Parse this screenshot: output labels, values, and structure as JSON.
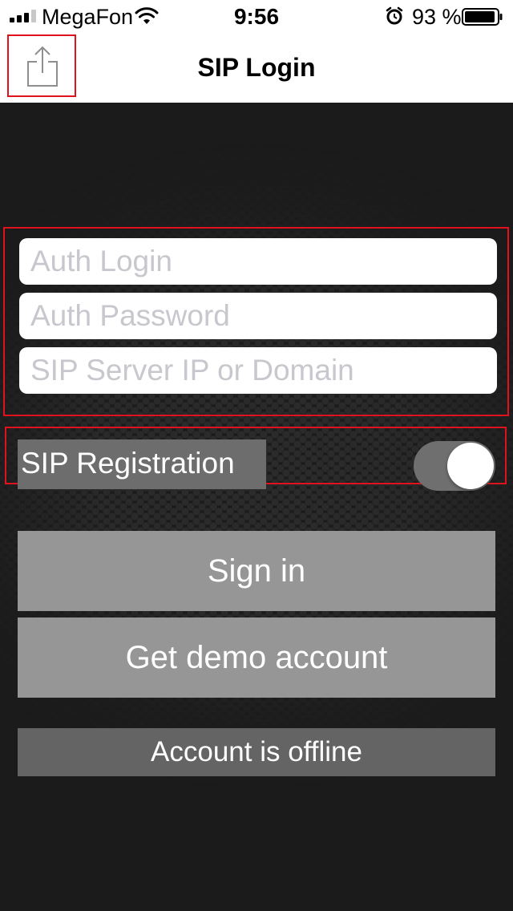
{
  "status_bar": {
    "carrier": "MegaFon",
    "time": "9:56",
    "battery_percent": "93 %",
    "signal_bars_filled": 3,
    "signal_bars_total": 4,
    "icons": [
      "signal-icon",
      "wifi-icon",
      "alarm-icon",
      "battery-icon"
    ]
  },
  "nav": {
    "title": "SIP Login",
    "share_icon": "share-icon"
  },
  "form": {
    "auth_login_placeholder": "Auth Login",
    "auth_password_placeholder": "Auth Password",
    "sip_server_placeholder": "SIP Server IP or Domain",
    "auth_login_value": "",
    "auth_password_value": "",
    "sip_server_value": ""
  },
  "registration": {
    "label": "SIP Registration",
    "toggle_on": true
  },
  "buttons": {
    "sign_in": "Sign in",
    "demo": "Get demo account"
  },
  "account_status": "Account is offline",
  "colors": {
    "highlight_border": "#e0121d",
    "button_bg": "#969696",
    "status_bg": "#646464",
    "background": "#1b1b1b"
  }
}
